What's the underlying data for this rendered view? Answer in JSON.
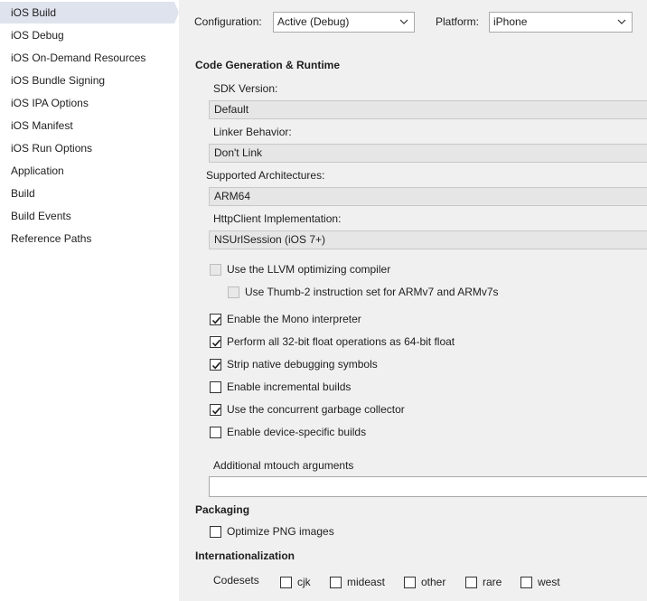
{
  "sidebar": {
    "items": [
      {
        "label": "iOS Build",
        "active": true
      },
      {
        "label": "iOS Debug"
      },
      {
        "label": "iOS On-Demand Resources"
      },
      {
        "label": "iOS Bundle Signing"
      },
      {
        "label": "iOS IPA Options"
      },
      {
        "label": "iOS Manifest"
      },
      {
        "label": "iOS Run Options"
      },
      {
        "label": "Application"
      },
      {
        "label": "Build"
      },
      {
        "label": "Build Events"
      },
      {
        "label": "Reference Paths"
      }
    ]
  },
  "config_bar": {
    "configuration_label": "Configuration:",
    "configuration_value": "Active (Debug)",
    "platform_label": "Platform:",
    "platform_value": "iPhone"
  },
  "code_gen": {
    "title": "Code Generation & Runtime",
    "sdk_version_label": "SDK Version:",
    "sdk_version_value": "Default",
    "linker_label": "Linker Behavior:",
    "linker_value": "Don't Link",
    "arch_label": "Supported Architectures:",
    "arch_value": "ARM64",
    "httpclient_label": "HttpClient Implementation:",
    "httpclient_value": "NSUrlSession (iOS 7+)",
    "options": [
      {
        "label": "Use the LLVM optimizing compiler",
        "checked": false,
        "disabled": true
      },
      {
        "label": "Use Thumb-2 instruction set for ARMv7 and ARMv7s",
        "checked": false,
        "disabled": true
      },
      {
        "label": "Enable the Mono interpreter",
        "checked": true
      },
      {
        "label": "Perform all 32-bit float operations as 64-bit float",
        "checked": true
      },
      {
        "label": "Strip native debugging symbols",
        "checked": true
      },
      {
        "label": "Enable incremental builds",
        "checked": false
      },
      {
        "label": "Use the concurrent garbage collector",
        "checked": true
      },
      {
        "label": "Enable device-specific builds",
        "checked": false
      }
    ],
    "mtouch_label": "Additional mtouch arguments",
    "mtouch_value": ""
  },
  "packaging": {
    "title": "Packaging",
    "optimize_png_label": "Optimize PNG images",
    "optimize_png_checked": false
  },
  "i18n": {
    "title": "Internationalization",
    "codesets_label": "Codesets",
    "codesets": [
      {
        "label": "cjk",
        "checked": false
      },
      {
        "label": "mideast",
        "checked": false
      },
      {
        "label": "other",
        "checked": false
      },
      {
        "label": "rare",
        "checked": false
      },
      {
        "label": "west",
        "checked": false
      }
    ]
  },
  "colors": {
    "sidebar_active": "#dfe3ee",
    "panel_bg": "#f0f0f0",
    "field_bg": "#e6e6e6"
  }
}
